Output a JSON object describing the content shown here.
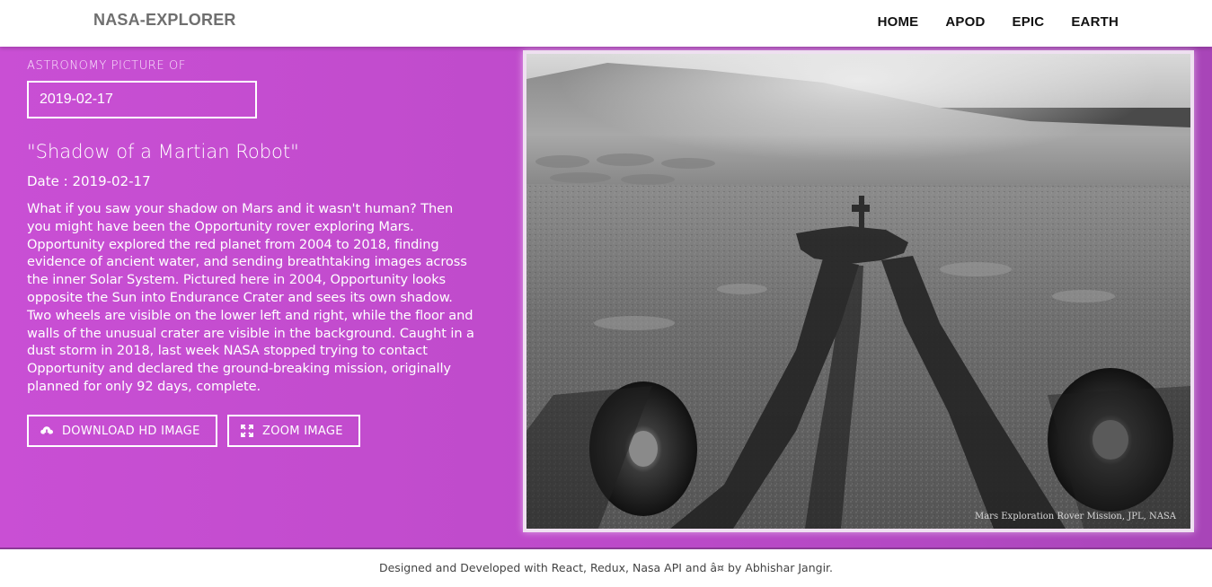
{
  "navbar": {
    "brand": "NASA-EXPLORER",
    "links": [
      "HOME",
      "APOD",
      "EPIC",
      "EARTH"
    ]
  },
  "apod": {
    "label": "ASTRONOMY PICTURE OF",
    "date_value": "2019-02-17",
    "title": "\"Shadow of a Martian Robot\"",
    "date_line": "Date : 2019-02-17",
    "explanation": "What if you saw your shadow on Mars and it wasn't human? Then you might have been the Opportunity rover exploring Mars. Opportunity explored the red planet from 2004 to 2018, finding evidence of ancient water, and sending breathtaking images across the inner Solar System. Pictured here in 2004, Opportunity looks opposite the Sun into Endurance Crater and sees its own shadow. Two wheels are visible on the lower left and right, while the floor and walls of the unusual crater are visible in the background. Caught in a dust storm in 2018, last week NASA stopped trying to contact Opportunity and declared the ground-breaking mission, originally planned for only 92 days, complete.",
    "download_label": "DOWNLOAD HD IMAGE",
    "zoom_label": "ZOOM IMAGE",
    "download_icon": "cloud-download-icon",
    "zoom_icon": "expand-icon"
  },
  "image": {
    "credit": "Mars Exploration Rover Mission, JPL, NASA"
  },
  "footer": {
    "text": "Designed and Developed with React, Redux, Nasa API and â¤ by Abhishar Jangir."
  },
  "colors": {
    "gradient_start": "#c94fd4",
    "gradient_end": "#a845b8",
    "brand_text": "#6f6f6f"
  }
}
